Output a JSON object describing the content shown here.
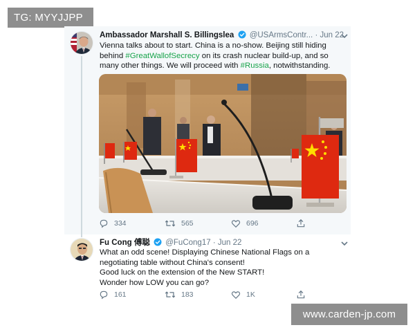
{
  "tag_badge": "TG: MYYJJPP",
  "watermark": "www.carden-jp.com",
  "tweet1": {
    "author_name": "Ambassador Marshall S. Billingslea",
    "handle": "@USArmsContr...",
    "separator": "·",
    "date": "Jun 22",
    "line1": "Vienna talks about to start. China is a no-show. Beijing still hiding",
    "line2_pre": "behind ",
    "hashtag1": "#GreatWallofSecrecy",
    "line2_post": " on its crash nuclear build-up, and so",
    "line3_pre": "many other things. We will proceed with ",
    "hashtag2": "#Russia",
    "line3_post": ", notwithstanding.",
    "replies": "334",
    "retweets": "565",
    "likes": "696"
  },
  "tweet2": {
    "author_name": "Fu Cong 傅聪",
    "handle": "@FuCong17",
    "separator": "·",
    "date": "Jun 22",
    "line1": "What an odd scene! Displaying Chinese National Flags on a",
    "line2": "negotiating table without China's consent!",
    "line3": "Good luck on the extension of the New START!",
    "line4": "Wonder how LOW you can go?",
    "replies": "161",
    "retweets": "183",
    "likes": "1K"
  },
  "colors": {
    "verified": "#1da1f2",
    "hashtag_green": "#17a34a",
    "muted": "#657786",
    "badge_bg": "#8e8e8e",
    "flag_red": "#de2910",
    "flag_star": "#ffde00"
  },
  "icons": [
    "reply-icon",
    "retweet-icon",
    "like-icon",
    "share-icon",
    "verified-icon",
    "chevron-down-icon"
  ]
}
